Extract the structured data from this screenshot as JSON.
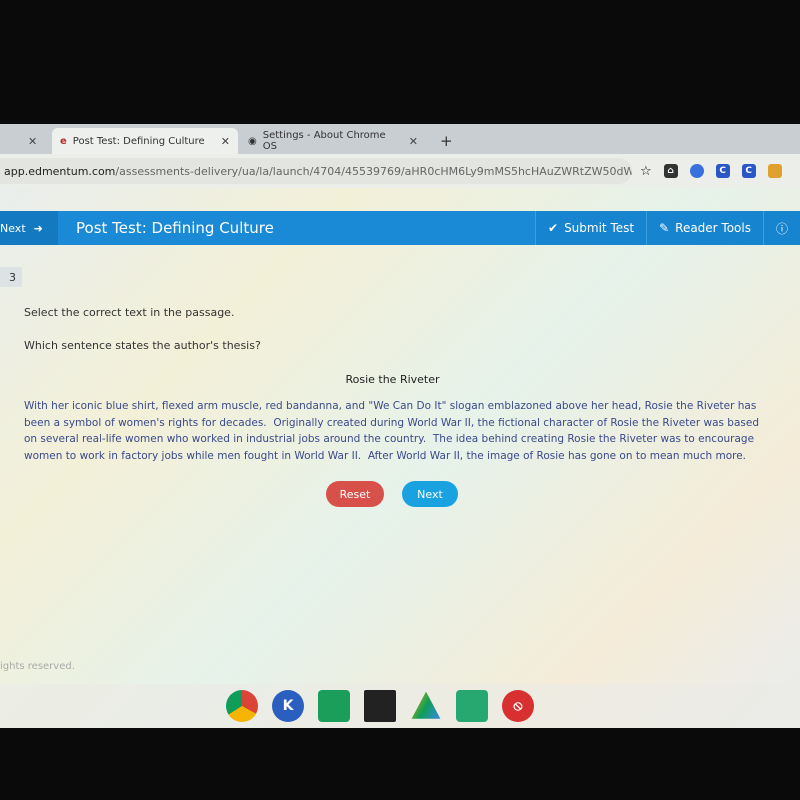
{
  "browser": {
    "tabs": [
      {
        "label": "Post Test: Defining Culture",
        "icon": "edmentum-icon"
      },
      {
        "label": "Settings - About Chrome OS",
        "icon": "settings-globe-icon"
      }
    ],
    "url_domain": "app.edmentum.com",
    "url_path": "/assessments-delivery/ua/la/launch/4704/45539769/aHR0cHM6Ly9mMS5hcHAuZWRtZW50dW0uY29t...",
    "extensions": [
      "C",
      "C"
    ]
  },
  "header": {
    "prev_label": "Next",
    "title": "Post Test: Defining Culture",
    "submit_label": "Submit Test",
    "reader_tools_label": "Reader Tools"
  },
  "question": {
    "number": "3",
    "instruction": "Select the correct text in the passage.",
    "prompt": "Which sentence states the author's thesis?",
    "passage_title": "Rosie the Riveter",
    "sentences": [
      "With her iconic blue shirt, flexed arm muscle, red bandanna, and \"We Can Do It\" slogan emblazoned above her head, Rosie the Riveter has been a symbol of women's rights for decades.",
      "Originally created during World War II, the fictional character of Rosie the Riveter was based on several real-life women who worked in industrial jobs around the country.",
      "The idea behind creating Rosie the Riveter was to encourage women to work in factory jobs while men fought in World War II.",
      "After World War II, the image of Rosie has gone on to mean much more."
    ]
  },
  "buttons": {
    "reset": "Reset",
    "next": "Next"
  },
  "footer": "ights reserved.",
  "colors": {
    "header": "#1a8ad6",
    "reset": "#d8504a",
    "next": "#1aa2e0"
  }
}
